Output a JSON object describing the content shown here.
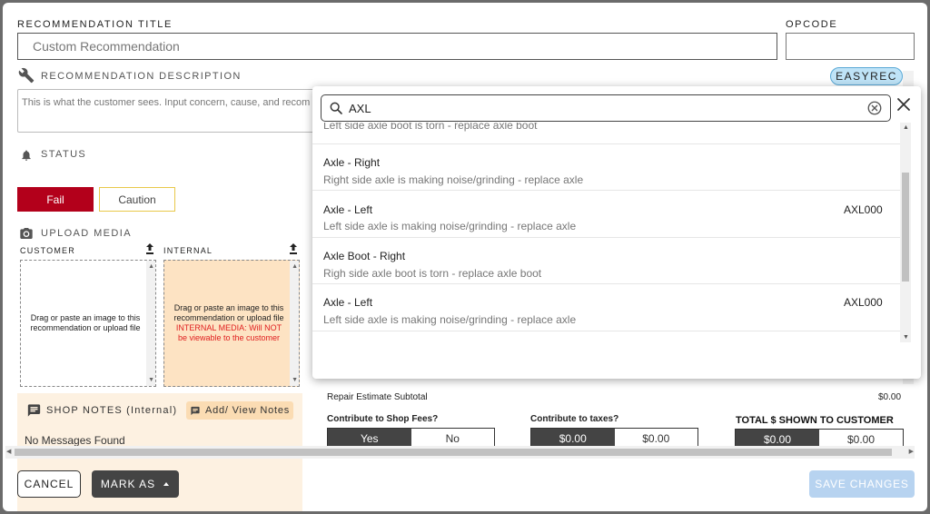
{
  "form": {
    "title_label": "RECOMMENDATION TITLE",
    "title_value": "Custom Recommendation",
    "opcode_label": "OPCODE",
    "opcode_value": "",
    "description_label": "RECOMMENDATION DESCRIPTION",
    "description_placeholder": "This is what the customer sees. Input concern, cause, and recom",
    "easyrec_label": "EASYREC",
    "status_label": "STATUS",
    "status_buttons": {
      "fail": "Fail",
      "caution": "Caution"
    },
    "upload_label": "UPLOAD MEDIA",
    "customer_label": "CUSTOMER",
    "internal_label": "INTERNAL",
    "customer_drop_text": "Drag or paste an image to this recommendation or upload file",
    "internal_drop_text": "Drag or paste an image to this recommendation or upload file",
    "internal_warning": "INTERNAL MEDIA: Will NOT be viewable to the customer"
  },
  "notes": {
    "label": "SHOP NOTES (Internal)",
    "add_button": "Add/ View Notes",
    "empty": "No Messages Found"
  },
  "estimate": {
    "subtotal_label": "Repair Estimate Subtotal",
    "subtotal_value": "$0.00",
    "shop_fees_label": "Contribute to Shop Fees?",
    "shop_fees_options": [
      "Yes",
      "No"
    ],
    "taxes_label": "Contribute to taxes?",
    "taxes_options": [
      "$0.00",
      "$0.00"
    ],
    "total_label": "TOTAL $ SHOWN TO CUSTOMER",
    "total_options": [
      "$0.00",
      "$0.00"
    ]
  },
  "footer": {
    "cancel": "CANCEL",
    "mark_as": "MARK AS",
    "save": "SAVE CHANGES"
  },
  "search_popup": {
    "query": "AXL",
    "items": [
      {
        "title": "",
        "desc": "Left side axle boot is torn - replace axle boot",
        "code": ""
      },
      {
        "title": "Axle - Right",
        "desc": "Right side axle is making noise/grinding - replace axle",
        "code": ""
      },
      {
        "title": "Axle - Left",
        "desc": "Left side axle is making noise/grinding - replace axle",
        "code": "AXL000"
      },
      {
        "title": "Axle Boot - Right",
        "desc": "Righ side axle boot is torn - replace axle boot",
        "code": ""
      },
      {
        "title": "Axle - Left",
        "desc": "Left side axle is making noise/grinding - replace axle",
        "code": "AXL000"
      }
    ]
  },
  "colors": {
    "fail_red": "#b3001b",
    "caution_border": "#e8c84a",
    "internal_bg": "#fde3c3",
    "notes_bg": "#fdf1e1",
    "easyrec_bg": "#bfe3f7",
    "save_disabled": "#b7d3f0",
    "dark": "#444444"
  },
  "icons": [
    "wrench-icon",
    "bell-icon",
    "camera-icon",
    "upload-icon",
    "chat-icon",
    "search-icon",
    "clear-circle-icon",
    "close-icon",
    "caret-up-icon"
  ]
}
